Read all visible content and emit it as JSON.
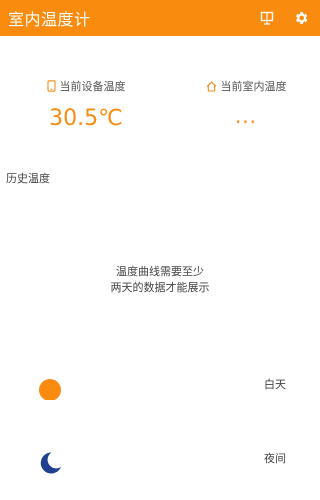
{
  "app": {
    "title": "室内温度计"
  },
  "colors": {
    "accent": "#f98b0f",
    "night": "#1f3f8f",
    "text": "#444444"
  },
  "toolbar": {
    "icons": [
      "reading-icon",
      "gear-icon"
    ]
  },
  "readings": {
    "device": {
      "label": "当前设备温度",
      "value": "30.5℃",
      "icon": "phone-icon"
    },
    "room": {
      "label": "当前室内温度",
      "value": "...",
      "icon": "home-icon"
    }
  },
  "history": {
    "label": "历史温度",
    "empty_line1": "温度曲线需要至少",
    "empty_line2": "两天的数据才能展示"
  },
  "legend": {
    "day": {
      "label": "白天",
      "icon": "sun-icon"
    },
    "night": {
      "label": "夜间",
      "icon": "moon-icon"
    }
  }
}
